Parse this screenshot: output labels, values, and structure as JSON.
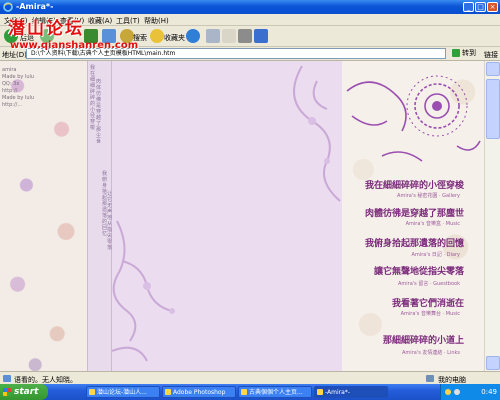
{
  "window": {
    "title": "-Amira*-",
    "buttons": {
      "minimize": "_",
      "maximize": "□",
      "close": "×"
    }
  },
  "menu": [
    "文件(F)",
    "编辑(E)",
    "查看(V)",
    "收藏(A)",
    "工具(T)",
    "帮助(H)"
  ],
  "toolbar": {
    "back_label": "后退",
    "search_label": "搜索",
    "favorites_label": "收藏夹"
  },
  "address": {
    "label": "地址(D)",
    "value": "D:\\个人资料\\下载\\古典个人主页模板HTML\\main.htm",
    "go_label": "转到",
    "links_label": "链接"
  },
  "watermark": {
    "chinese": "潜山论坛",
    "url": "www.qianshanren.com"
  },
  "left_text": [
    "amira",
    "Made by lulu",
    "QQ: 3x",
    "http://",
    "Made by lulu",
    "http://..."
  ],
  "vertical_text": [
    "我在细细碎碎的小径穿梭",
    "肉体仿佛是穿越了那尘世",
    "我俯身拾起那遗落的回忆",
    "让它无声地从指尖零落"
  ],
  "poem": [
    {
      "text": "我在細細碎碎的小徑穿梭",
      "sub": "Amira's 秘密花園 · Gallery"
    },
    {
      "text": "肉體彷彿是穿越了那塵世",
      "sub": "Amira's 音樂盒 · Music"
    },
    {
      "text": "我俯身拾起那遺落的回憶",
      "sub": "Amira's 日記 · Diary"
    },
    {
      "text": "讓它無聲地從指尖零落",
      "sub": "Amira's 留言 · Guestbook"
    },
    {
      "text": "我看著它們消逝在",
      "sub": "Amira's 音樂舞台 · Music"
    },
    {
      "text": "那細細碎碎的小道上",
      "sub": "Amira's 友情連結 · Links"
    }
  ],
  "statusbar": {
    "text": "语看的。无人知晓。",
    "zone": "我的电脑"
  },
  "taskbar": {
    "start_label": "start",
    "tasks": [
      "潜山论坛-潜山人...",
      "Adobe Photoshop",
      "古典個個个人主页...",
      "-Amira*-"
    ],
    "clock": "0:49"
  },
  "colors": {
    "titlebar": "#0b55d9",
    "content_bg": "#ecdcef",
    "poem_text": "#7a2a7a",
    "watermark": "#e01010",
    "taskbar": "#245edb",
    "start": "#3ea83a"
  }
}
